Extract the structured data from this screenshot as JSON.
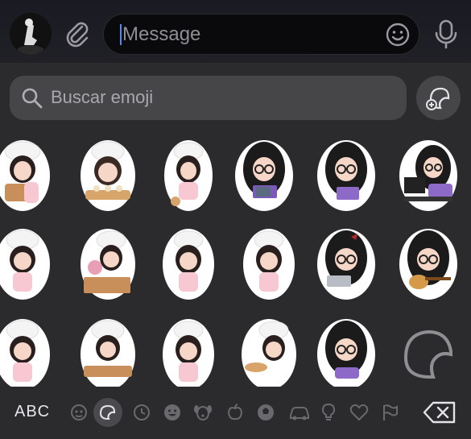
{
  "composer": {
    "message_placeholder": "Message",
    "icons": [
      "avatar",
      "paperclip-icon",
      "emoji-icon",
      "microphone-icon"
    ]
  },
  "emoji_panel": {
    "search_placeholder": "Buscar emoji",
    "sticker_button_icon": "add-sticker-icon",
    "sticker_rows": 3,
    "sticker_cols": 6,
    "last_cell_icon": "sticker-outline-icon"
  },
  "keyboard_bar": {
    "abc_label": "ABC",
    "selected_category": "stickers",
    "categories": [
      "recent-people",
      "stickers",
      "clock",
      "smileys",
      "animals",
      "food",
      "activity",
      "travel",
      "objects",
      "symbols",
      "flags"
    ],
    "delete_icon": "backspace-icon"
  },
  "colors": {
    "panel_bg": "#2b2b2d",
    "search_bg": "#464649",
    "caret": "#4b8cf5",
    "icon_gray": "#8e8e93"
  }
}
